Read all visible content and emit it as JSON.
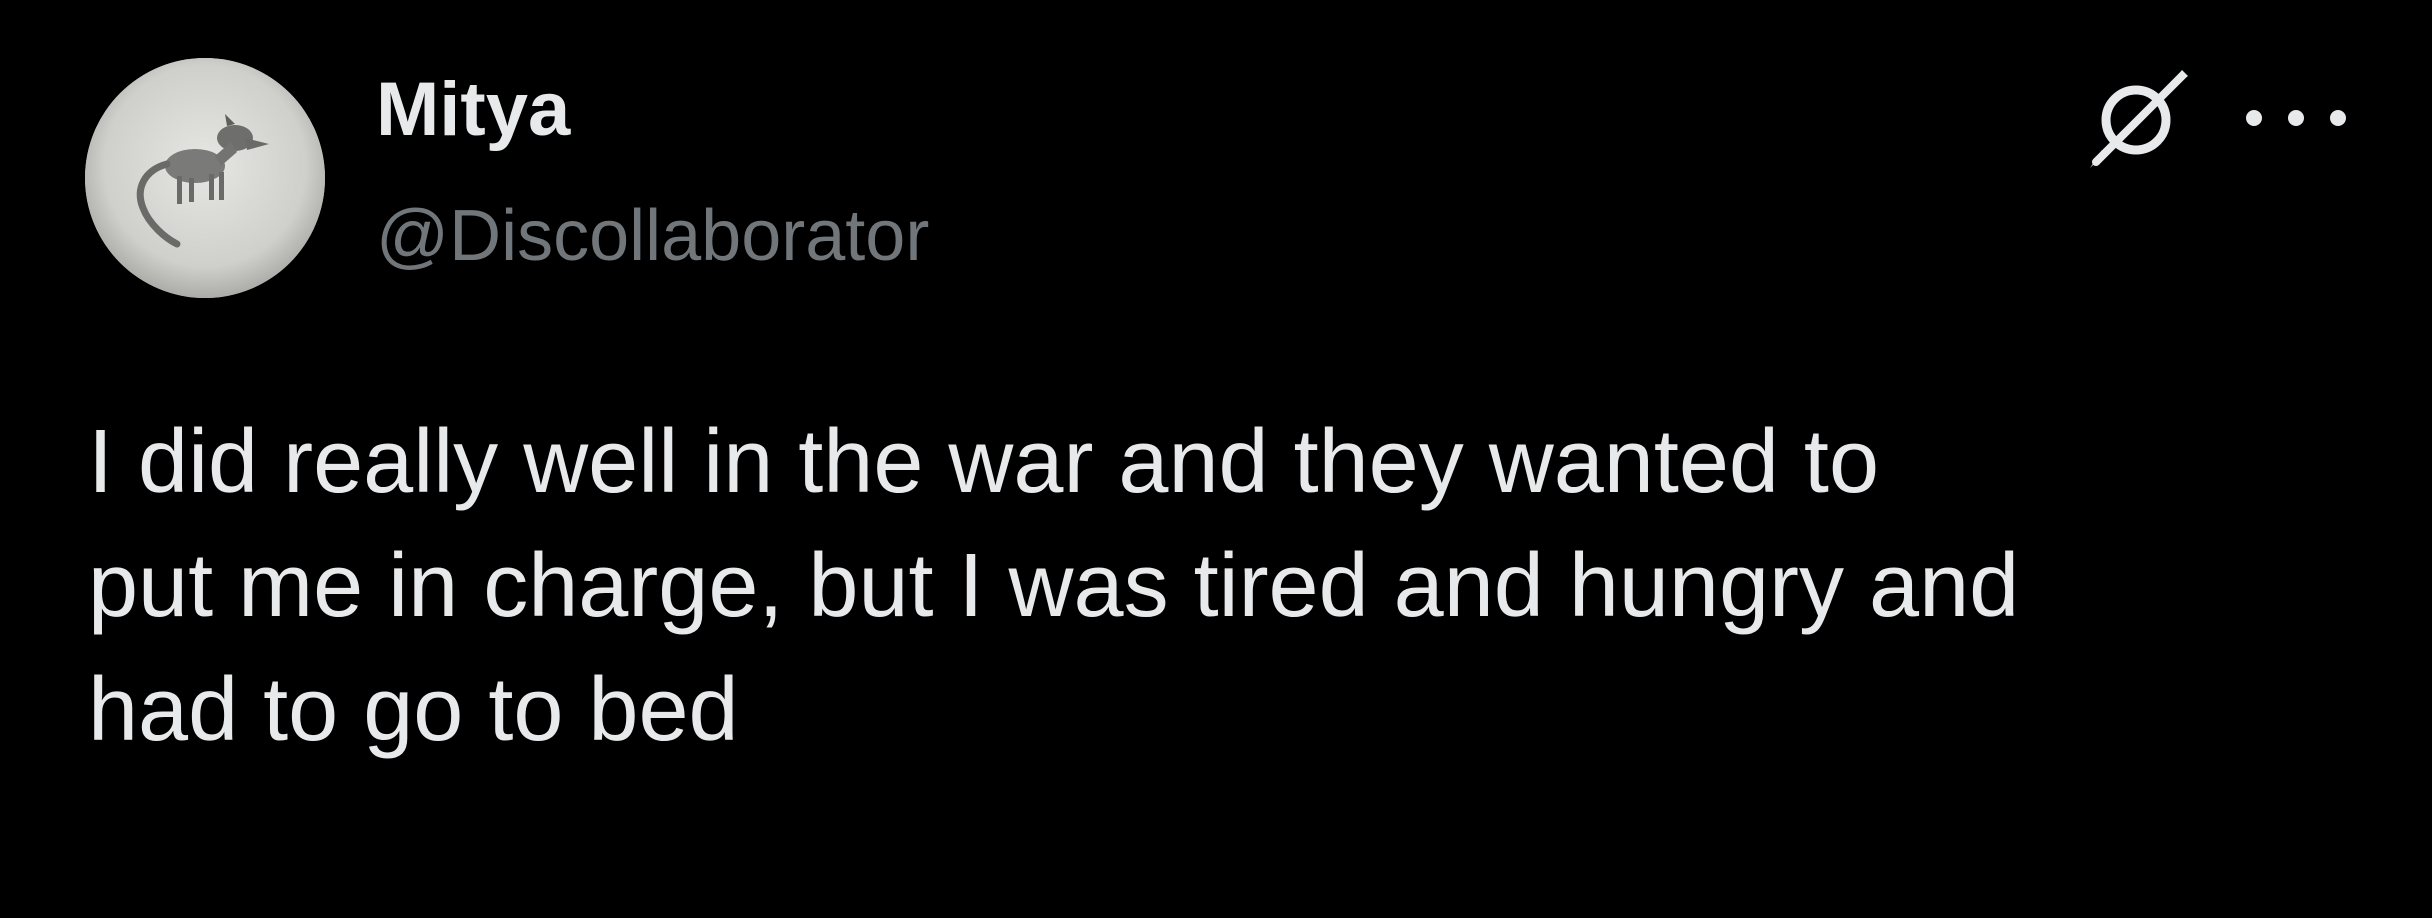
{
  "author": {
    "display_name": "Mitya",
    "handle": "@Discollaborator",
    "avatar_icon": "dog-photo-avatar"
  },
  "actions": {
    "grok_icon": "grok-icon",
    "more_icon": "more-horizontal-icon"
  },
  "tweet": {
    "lines": [
      "I did really well in the war and they wanted to",
      "put me in charge, but I was tired and hungry and",
      "had to go to bed"
    ]
  },
  "colors": {
    "background": "#000000",
    "primary_text": "#e7e9ea",
    "secondary_text": "#71767b"
  }
}
